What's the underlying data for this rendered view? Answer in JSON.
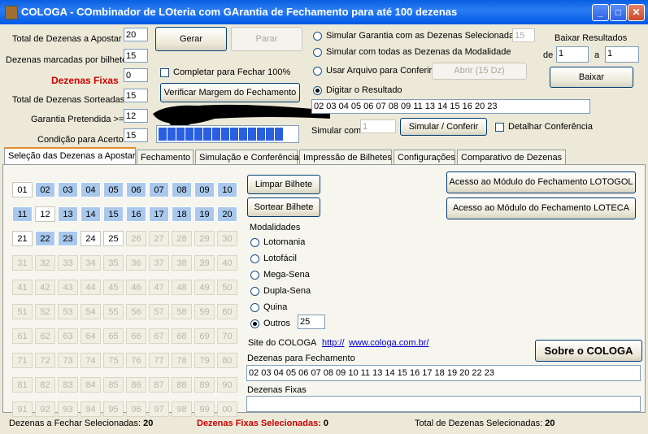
{
  "window": {
    "title": "COLOGA - COmbinador de LOteria com GArantia de Fechamento para até 100 dezenas"
  },
  "left_form": {
    "total_label": "Total de Dezenas a Apostar",
    "total_value": "20",
    "marcadas_label": "Dezenas marcadas por bilhete",
    "marcadas_value": "15",
    "fixas_label": "Dezenas Fixas",
    "fixas_value": "0",
    "sorteadas_label": "Total de Dezenas Sorteadas",
    "sorteadas_value": "15",
    "garantia_label": "Garantia Pretendida >=",
    "garantia_value": "12",
    "condicao_label": "Condição para Acerto",
    "condicao_value": "15",
    "fixas_color": "#cc0000"
  },
  "middle": {
    "gerar": "Gerar",
    "parar": "Parar",
    "completar_label": "Completar para Fechar 100%",
    "verificar": "Verificar Margem do Fechamento",
    "progress_fraction": 0.9
  },
  "simulacao": {
    "opt1": "Simular Garantia com as Dezenas Selecionadas",
    "opt1_value": "15",
    "opt2": "Simular com todas as Dezenas da Modalidade",
    "opt3": "Usar Arquivo para Conferir",
    "abrir": "Abrir (15 Dz)",
    "opt4": "Digitar o Resultado",
    "resultado": "02 03 04 05 06 07 08 09 11 13 14 15 16 20 23",
    "simular_com_label": "Simular com",
    "simular_com_value": "1",
    "simular_button": "Simular / Conferir",
    "detalhar_label": "Detalhar Conferência"
  },
  "baixar": {
    "title": "Baixar Resultados",
    "de_label": "de",
    "de_value": "1",
    "a_label": "a",
    "a_value": "1",
    "button": "Baixar"
  },
  "tabs": [
    "Seleção das Dezenas a Apostar",
    "Fechamento",
    "Simulação e Conferência",
    "Impressão de Bilhetes",
    "Configurações",
    "Comparativo de Dezenas"
  ],
  "grid": {
    "numbers": [
      "01",
      "02",
      "03",
      "04",
      "05",
      "06",
      "07",
      "08",
      "09",
      "10",
      "11",
      "12",
      "13",
      "14",
      "15",
      "16",
      "17",
      "18",
      "19",
      "20",
      "21",
      "22",
      "23",
      "24",
      "25",
      "26",
      "27",
      "28",
      "29",
      "30",
      "31",
      "32",
      "33",
      "34",
      "35",
      "36",
      "37",
      "38",
      "39",
      "40",
      "41",
      "42",
      "43",
      "44",
      "45",
      "46",
      "47",
      "48",
      "49",
      "50",
      "51",
      "52",
      "53",
      "54",
      "55",
      "56",
      "57",
      "58",
      "59",
      "60",
      "61",
      "62",
      "63",
      "64",
      "65",
      "66",
      "67",
      "68",
      "69",
      "70",
      "71",
      "72",
      "73",
      "74",
      "75",
      "76",
      "77",
      "78",
      "79",
      "80",
      "81",
      "82",
      "83",
      "84",
      "85",
      "86",
      "87",
      "88",
      "89",
      "90",
      "91",
      "92",
      "93",
      "94",
      "95",
      "96",
      "97",
      "98",
      "99",
      "00"
    ],
    "selected": [
      "02",
      "03",
      "04",
      "05",
      "06",
      "07",
      "08",
      "09",
      "10",
      "11",
      "13",
      "14",
      "15",
      "16",
      "17",
      "18",
      "19",
      "20",
      "22",
      "23"
    ],
    "available_max": 25
  },
  "panel": {
    "limpar": "Limpar Bilhete",
    "sortear": "Sortear Bilhete",
    "modalidades_label": "Modalidades",
    "modalidades": [
      "Lotomania",
      "Lotofácil",
      "Mega-Sena",
      "Dupla-Sena",
      "Quina",
      "Outros"
    ],
    "outros_value": "25",
    "lotogol_button": "Acesso ao Módulo do Fechamento LOTOGOL",
    "loteca_button": "Acesso ao Módulo do Fechamento LOTECA",
    "site_label": "Site do COLOGA",
    "site_http": "http://",
    "site_url": "www.cologa.com.br/",
    "sobre_button": "Sobre o COLOGA",
    "fechamento_label": "Dezenas para Fechamento",
    "fechamento_value": "02 03 04 05 06 07 08 09 10 11 13 14 15 16 17 18 19 20 22 23",
    "fixas_label": "Dezenas Fixas",
    "fixas_value": ""
  },
  "status": {
    "fechar_label": "Dezenas a Fechar Selecionadas:",
    "fechar_value": "20",
    "fixas_label": "Dezenas Fixas Selecionadas:",
    "fixas_value": "0",
    "total_label": "Total de Dezenas Selecionadas:",
    "total_value": "20",
    "fixas_color": "#cc0000"
  }
}
